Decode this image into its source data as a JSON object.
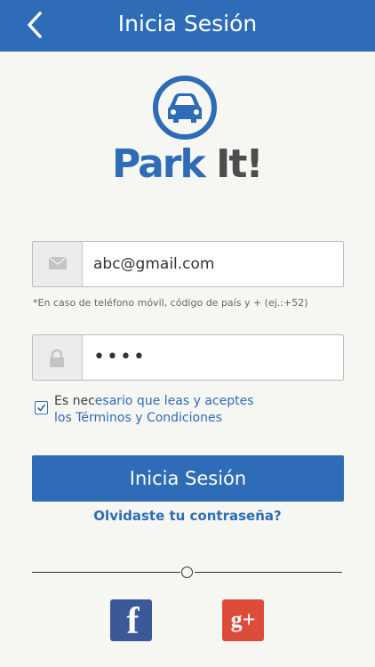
{
  "header": {
    "title": "Inicia Sesión",
    "back_icon": "chevron-left-icon"
  },
  "logo": {
    "text_part1": "Park",
    "text_part2": "It!",
    "icon": "car-icon"
  },
  "email_field": {
    "value": "abc@gmail.com",
    "icon": "envelope-icon"
  },
  "hint": "*En caso de teléfono móvil, código de país y + (ej.:+52)",
  "password_field": {
    "value": "••••",
    "icon": "lock-icon"
  },
  "terms": {
    "checked": true,
    "line1_prefix": "Es nec",
    "line1_link": "esario que leas y aceptes",
    "line2": "los Términos y Condiciones"
  },
  "login_button": "Inicia Sesión",
  "forgot_password": "Olvidaste tu contraseña?",
  "social": [
    {
      "name": "facebook",
      "glyph": "f",
      "color": "#3b5998"
    },
    {
      "name": "google-plus",
      "glyph": "g+",
      "color": "#dd4b39"
    }
  ],
  "colors": {
    "primary": "#2e6cb7",
    "background": "#f6f6f3"
  }
}
